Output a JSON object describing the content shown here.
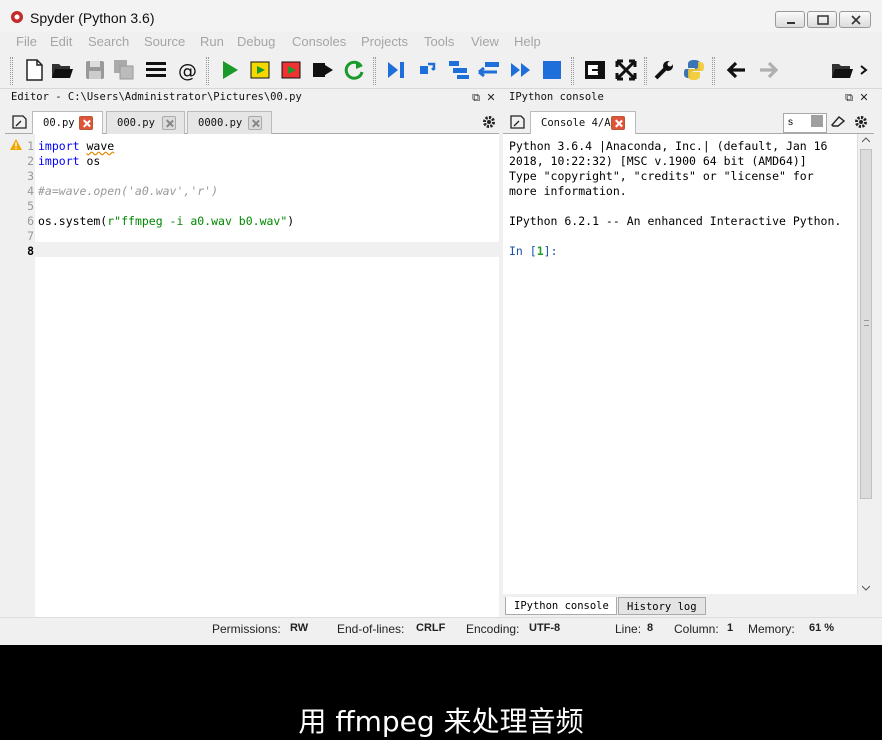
{
  "window": {
    "title": "Spyder (Python 3.6)"
  },
  "menu": [
    "File",
    "Edit",
    "Search",
    "Source",
    "Run",
    "Debug",
    "Consoles",
    "Projects",
    "Tools",
    "View",
    "Help"
  ],
  "toolbar": {
    "directory_value": "s"
  },
  "editor": {
    "title": "Editor - C:\\Users\\Administrator\\Pictures\\00.py",
    "tabs": [
      "00.py",
      "000.py",
      "0000.py"
    ],
    "line_numbers": [
      "1",
      "2",
      "3",
      "4",
      "5",
      "6",
      "7",
      "8"
    ],
    "code": {
      "l1_kw": "import",
      "l1_mod": "wave",
      "l2_kw": "import",
      "l2_rest": " os",
      "l4": "#a=wave.open('a0.wav','r')",
      "l6_a": "os.system(",
      "l6_s": "r\"ffmpeg -i a0.wav b0.wav\"",
      "l6_b": ")"
    }
  },
  "console": {
    "title": "IPython console",
    "tab": "Console 4/A",
    "lines": [
      "Python 3.6.4 |Anaconda, Inc.| (default, Jan 16",
      "2018, 10:22:32) [MSC v.1900 64 bit (AMD64)]",
      "Type \"copyright\", \"credits\" or \"license\" for",
      "more information.",
      "IPython 6.2.1 -- An enhanced Interactive Python."
    ],
    "prompt_in": "In [",
    "prompt_num": "1",
    "prompt_end": "]:",
    "bottom_tabs": [
      "IPython console",
      "History log"
    ]
  },
  "status": {
    "permissions_label": "Permissions:",
    "permissions": "RW",
    "eol_label": "End-of-lines:",
    "eol": "CRLF",
    "encoding_label": "Encoding:",
    "encoding": "UTF-8",
    "line_label": "Line:",
    "line": "8",
    "column_label": "Column:",
    "column": "1",
    "memory_label": "Memory:",
    "memory": "61 %"
  },
  "subtitle": "用 ffmpeg 来处理音频"
}
